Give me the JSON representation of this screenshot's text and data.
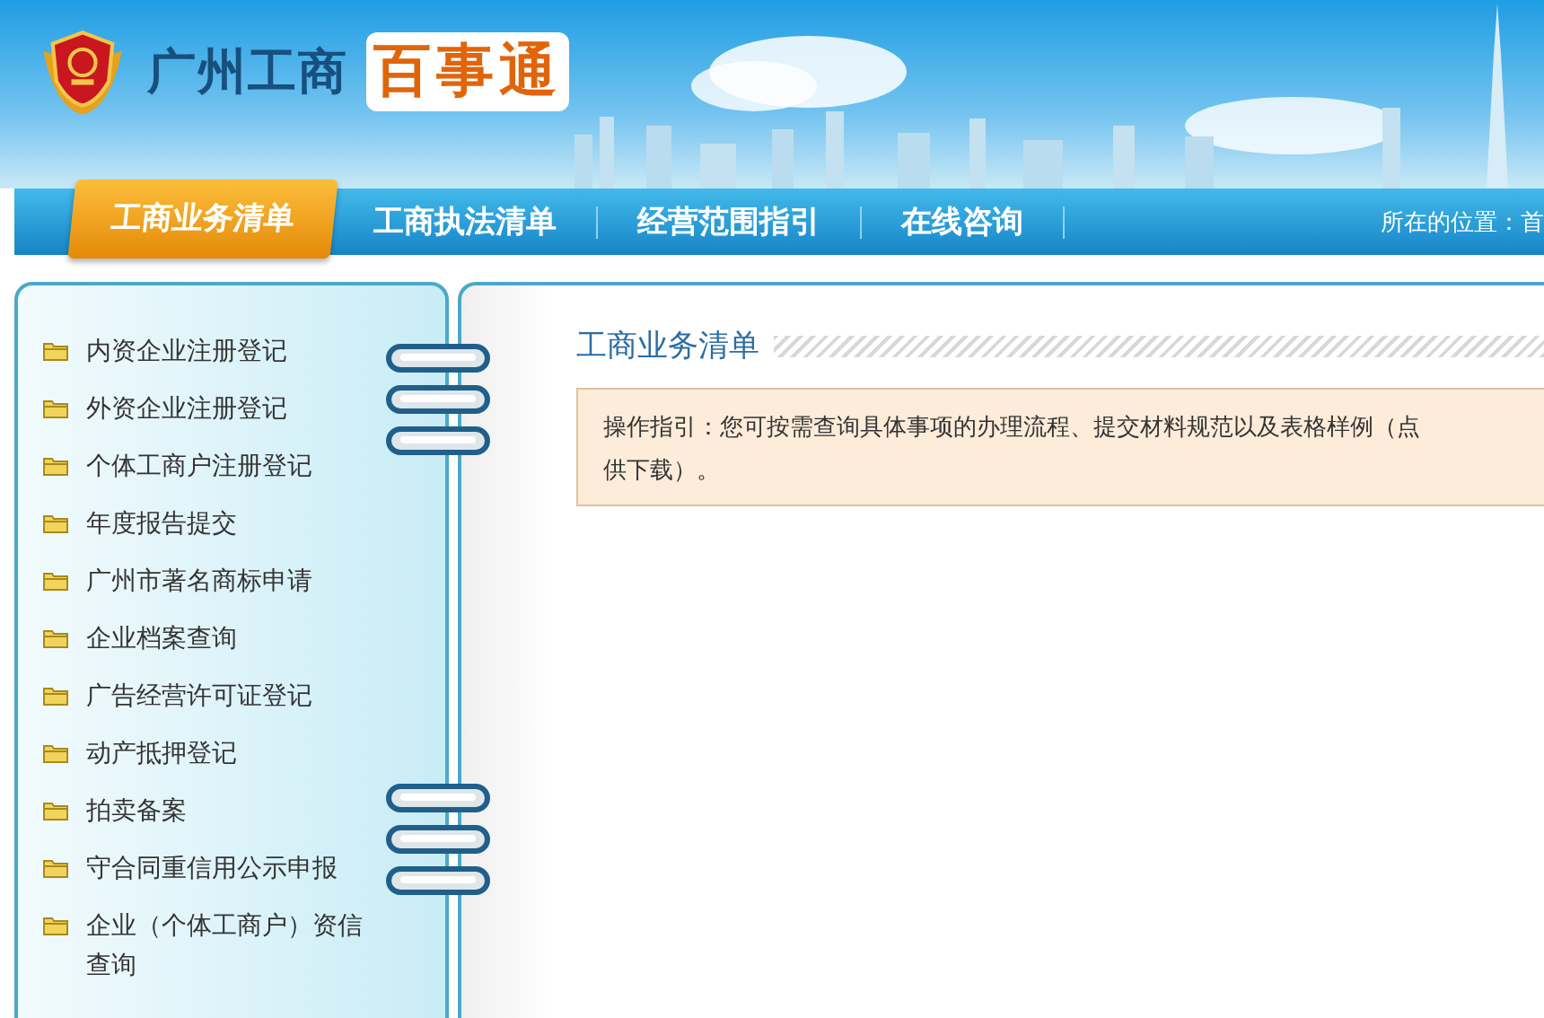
{
  "header": {
    "title": "广州工商",
    "title_highlight": "百事通"
  },
  "nav": {
    "tabs": [
      {
        "label": "工商业务清单",
        "selected": true
      },
      {
        "label": "工商执法清单",
        "selected": false
      },
      {
        "label": "经营范围指引",
        "selected": false
      },
      {
        "label": "在线咨询",
        "selected": false
      }
    ],
    "breadcrumb": "所在的位置：首"
  },
  "sidebar": {
    "items": [
      "内资企业注册登记",
      "外资企业注册登记",
      "个体工商户注册登记",
      "年度报告提交",
      "广州市著名商标申请",
      "企业档案查询",
      "广告经营许可证登记",
      "动产抵押登记",
      "拍卖备案",
      "守合同重信用公示申报",
      "企业（个体工商户）资信查询"
    ]
  },
  "main": {
    "title": "工商业务清单",
    "guide_lines": [
      "操作指引：您可按需查询具体事项的办理流程、提交材料规范以及表格样例（点",
      "供下载）。"
    ]
  }
}
